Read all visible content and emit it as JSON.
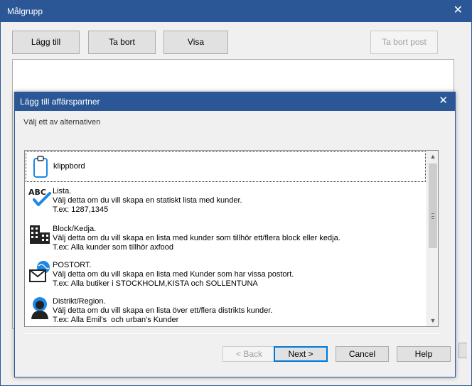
{
  "outer_window": {
    "title": "Målgrupp",
    "close_glyph": "✕",
    "buttons": {
      "add": "Lägg till",
      "remove": "Ta bort",
      "show": "Visa",
      "remove_post": "Ta bort post"
    }
  },
  "dialog": {
    "title": "Lägg till affärspartner",
    "close_glyph": "✕",
    "instruction": "Välj ett av alternativen",
    "items": [
      {
        "icon": "clipboard-icon",
        "text": "klippbord"
      },
      {
        "icon": "abc-check-icon",
        "icon_text": "ABC",
        "text": "Lista.\nVälj detta om du vill skapa en statiskt lista med kunder.\nT.ex: 1287,1345"
      },
      {
        "icon": "building-icon",
        "text": "Block/Kedja.\nVälj detta om du vill skapa en lista med kunder som tillhör ett/flera block eller kedja.\nT.ex: Alla kunder som tillhör axfood"
      },
      {
        "icon": "mail-globe-icon",
        "text": "POSTORT.\nVälj detta om du vill skapa en lista med Kunder som har vissa postort.\nT.ex: Alla butiker i STOCKHOLM,KISTA och SOLLENTUNA"
      },
      {
        "icon": "person-icon",
        "text": "Distrikt/Region.\nVälj detta om du vill skapa en lista över ett/flera distrikts kunder.\nT.ex: Alla Emil's  och urban's Kunder"
      }
    ],
    "buttons": {
      "back": "< Back",
      "next": "Next >",
      "cancel": "Cancel",
      "help": "Help"
    }
  },
  "colors": {
    "titlebar": "#2b5797",
    "accent": "#1e88e5"
  }
}
